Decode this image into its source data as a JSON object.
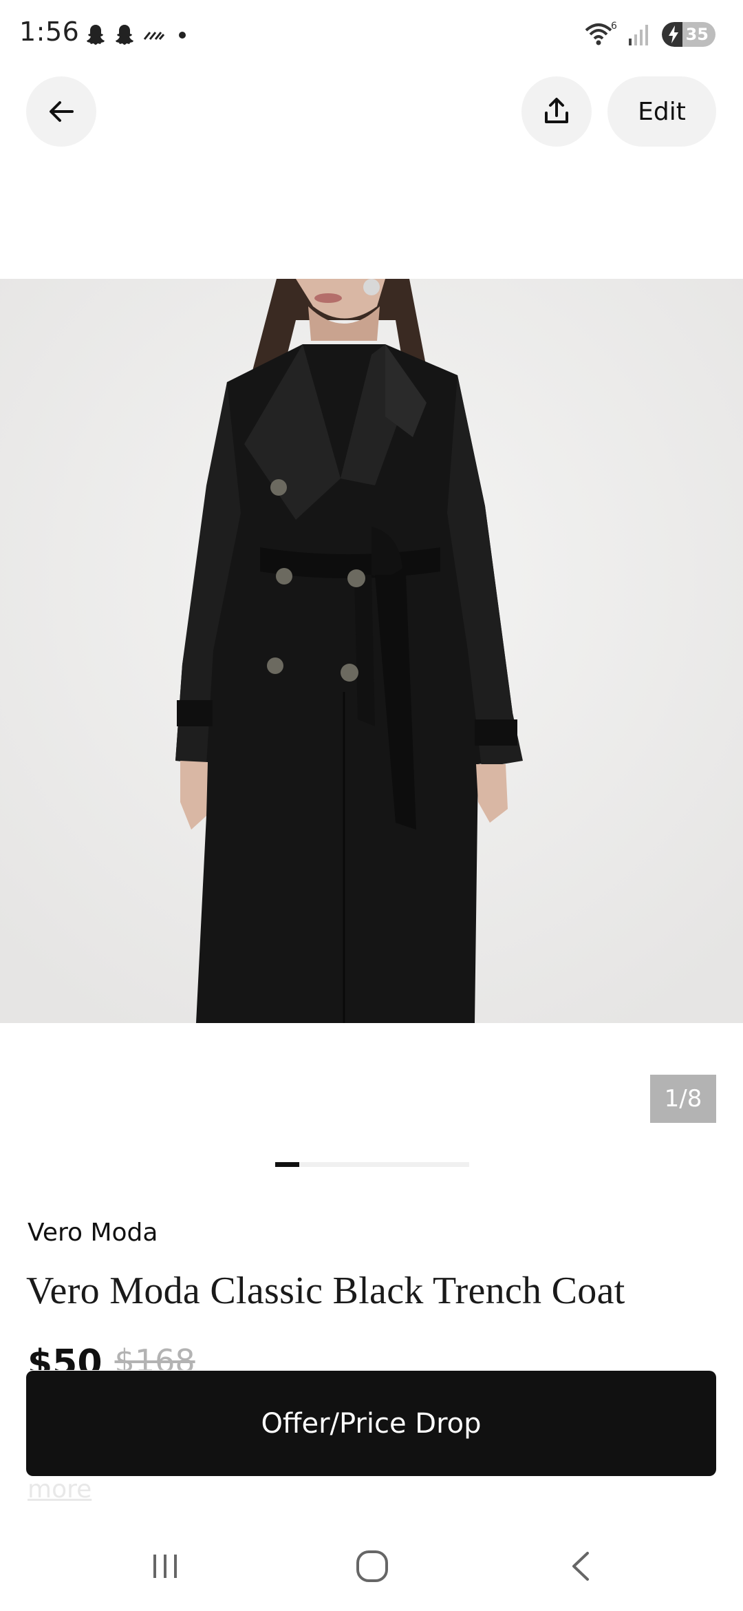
{
  "status_bar": {
    "time": "1:56",
    "battery_level": "35",
    "signal_label": "6"
  },
  "header": {
    "edit_label": "Edit"
  },
  "gallery": {
    "counter": "1/8",
    "current_index": 1,
    "total": 8
  },
  "product": {
    "brand": "Vero Moda",
    "title": "Vero Moda Classic Black Trench Coat",
    "price": "$50",
    "original_price": "$168",
    "more_link": "more"
  },
  "action": {
    "offer_label": "Offer/Price Drop"
  }
}
